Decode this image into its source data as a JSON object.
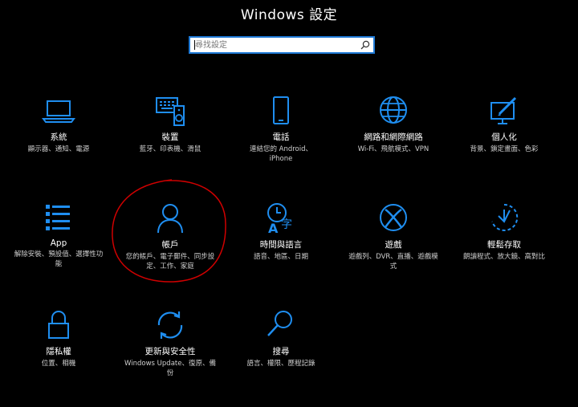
{
  "window": {
    "title": "Windows 設定"
  },
  "search": {
    "placeholder": "尋找設定"
  },
  "accent": "#1f8ef0",
  "tiles": [
    {
      "icon": "laptop-icon",
      "name": "系統",
      "desc": "顯示器、通知、電源"
    },
    {
      "icon": "devices-icon",
      "name": "裝置",
      "desc": "藍牙、印表機、滑鼠"
    },
    {
      "icon": "phone-icon",
      "name": "電話",
      "desc": "連結您的 Android、iPhone"
    },
    {
      "icon": "globe-icon",
      "name": "網路和網際網路",
      "desc": "Wi-Fi、飛航模式、VPN"
    },
    {
      "icon": "personalization-icon",
      "name": "個人化",
      "desc": "背景、鎖定畫面、色彩"
    },
    {
      "icon": "apps-list-icon",
      "name": "App",
      "desc": "解除安裝、預設值、選擇性功能"
    },
    {
      "icon": "person-icon",
      "name": "帳戶",
      "desc": "您的帳戶、電子郵件、同步設定、工作、家庭"
    },
    {
      "icon": "time-language-icon",
      "name": "時間與語言",
      "desc": "語音、地區、日期"
    },
    {
      "icon": "xbox-icon",
      "name": "遊戲",
      "desc": "遊戲列、DVR、直播、遊戲模式"
    },
    {
      "icon": "ease-of-access-icon",
      "name": "輕鬆存取",
      "desc": "朗讀程式、放大鏡、高對比"
    },
    {
      "icon": "lock-icon",
      "name": "隱私權",
      "desc": "位置、相機"
    },
    {
      "icon": "sync-icon",
      "name": "更新與安全性",
      "desc": "Windows Update、復原、備份"
    },
    {
      "icon": "search-icon",
      "name": "搜尋",
      "desc": "語言、權限、歷程記錄"
    }
  ]
}
